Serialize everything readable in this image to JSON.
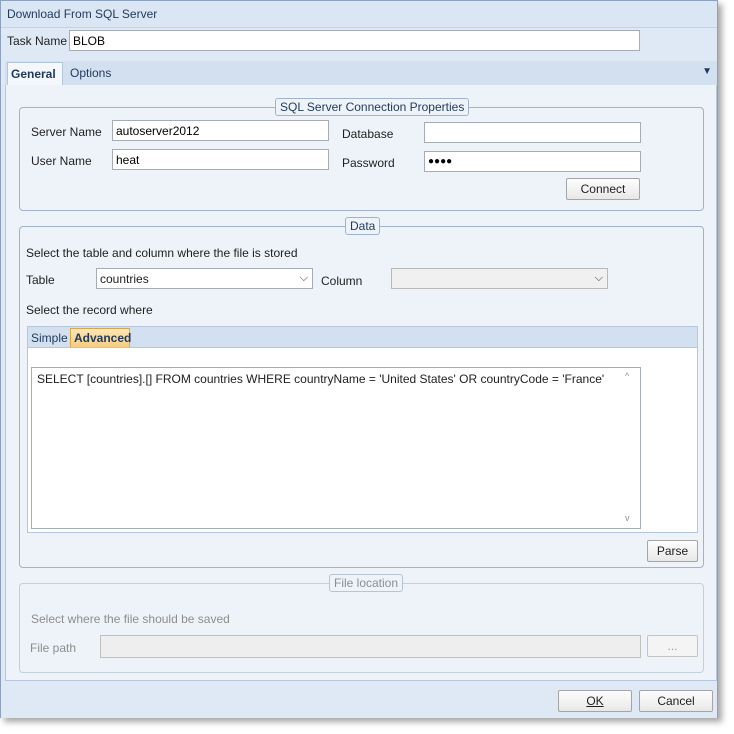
{
  "window": {
    "title": "Download From SQL Server"
  },
  "task": {
    "label": "Task Name",
    "value": "BLOB"
  },
  "tabs": [
    {
      "label": "General"
    },
    {
      "label": "Options"
    }
  ],
  "connection": {
    "title": "SQL Server Connection Properties",
    "server_label": "Server Name",
    "server_value": "autoserver2012",
    "database_label": "Database",
    "database_value": "",
    "user_label": "User Name",
    "user_value": "heat",
    "password_label": "Password",
    "password_value": "●●●●",
    "connect_label": "Connect"
  },
  "data": {
    "title": "Data",
    "instruction": "Select the table and column where the file is stored",
    "table_label": "Table",
    "table_value": "countries",
    "column_label": "Column",
    "column_value": "",
    "record_instruction": "Select the record where",
    "subtabs": [
      {
        "label": "Simple"
      },
      {
        "label": "Advanced"
      }
    ],
    "sql": "SELECT [countries].[] FROM countries WHERE countryName = 'United States' OR countryCode = 'France'",
    "parse_label": "Parse"
  },
  "file_location": {
    "title": "File location",
    "instruction": "Select where the file should be saved",
    "path_label": "File path",
    "path_value": "",
    "browse_label": "..."
  },
  "footer": {
    "ok_label": "OK",
    "cancel_label": "Cancel"
  }
}
